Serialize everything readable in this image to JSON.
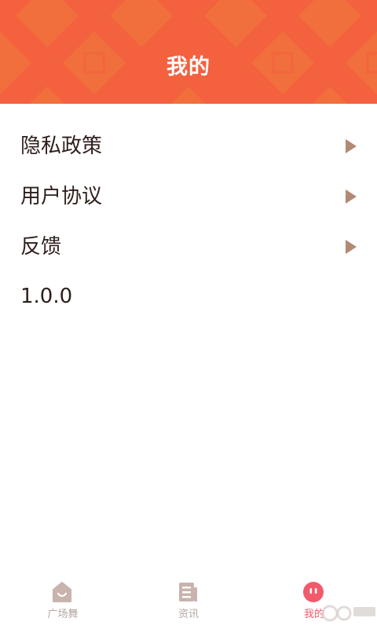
{
  "header": {
    "title": "我的",
    "color": "#f3613f"
  },
  "menu": {
    "items": [
      {
        "label": "隐私政策",
        "icon": "chevron-right-icon"
      },
      {
        "label": "用户协议",
        "icon": "chevron-right-icon"
      },
      {
        "label": "反馈",
        "icon": "chevron-right-icon"
      }
    ],
    "version": "1.0.0"
  },
  "tabbar": {
    "tabs": [
      {
        "label": "广场舞",
        "icon": "home-smile-icon",
        "active": false
      },
      {
        "label": "资讯",
        "icon": "news-icon",
        "active": false
      },
      {
        "label": "我的",
        "icon": "profile-face-icon",
        "active": true
      }
    ],
    "active_color": "#f25a6b",
    "inactive_color": "#b5a6a0"
  }
}
